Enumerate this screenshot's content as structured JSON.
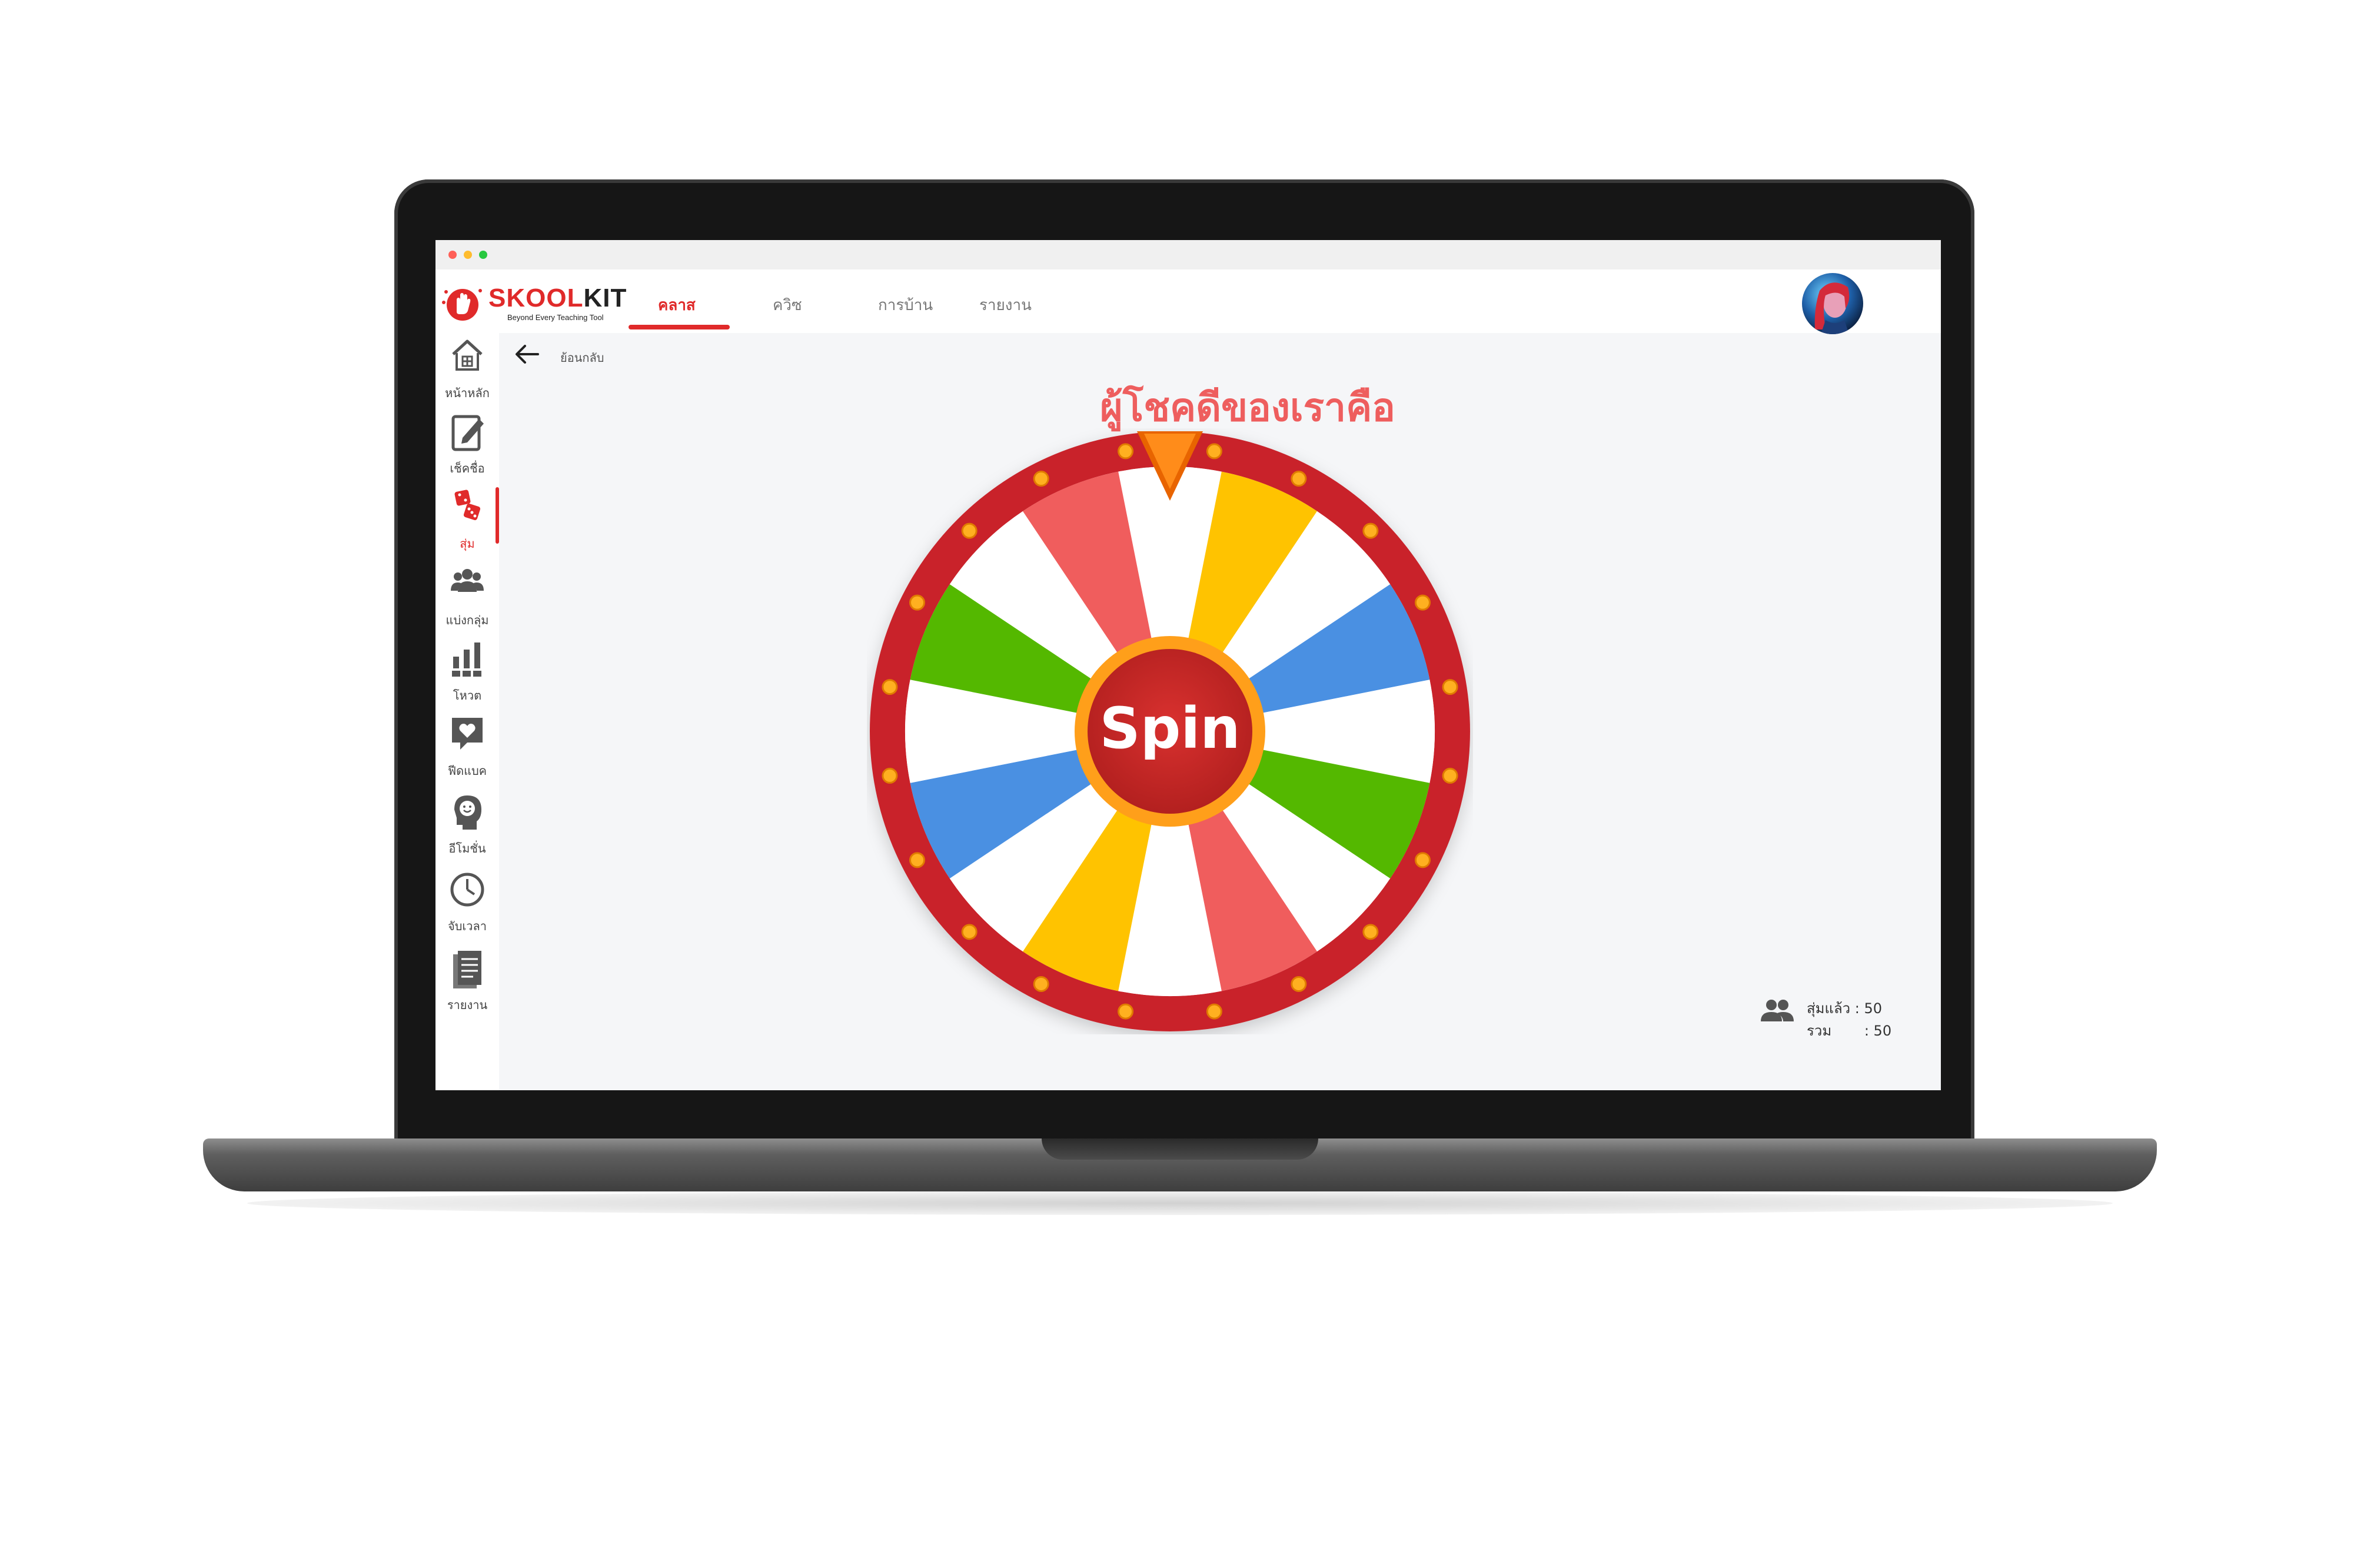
{
  "app": {
    "brand": {
      "name_red": "SKOOL",
      "name_dark": "KIT",
      "tagline": "Beyond Every Teaching Tool"
    },
    "window_dots": [
      "#ff5f57",
      "#febc2e",
      "#28c840"
    ]
  },
  "topnav": {
    "tabs": [
      {
        "label": "คลาส",
        "active": true
      },
      {
        "label": "ควิซ",
        "active": false
      },
      {
        "label": "การบ้าน",
        "active": false
      },
      {
        "label": "รายงาน",
        "active": false
      }
    ]
  },
  "sidebar": {
    "items": [
      {
        "label": "หน้าหลัก",
        "icon": "home-icon",
        "active": false
      },
      {
        "label": "เช็คชื่อ",
        "icon": "checklist-edit-icon",
        "active": false
      },
      {
        "label": "สุ่ม",
        "icon": "dice-icon",
        "active": true
      },
      {
        "label": "แบ่งกลุ่ม",
        "icon": "group-icon",
        "active": false
      },
      {
        "label": "โหวต",
        "icon": "vote-chart-icon",
        "active": false
      },
      {
        "label": "ฟีดแบค",
        "icon": "feedback-heart-icon",
        "active": false
      },
      {
        "label": "อีโมชั่น",
        "icon": "emotion-face-icon",
        "active": false
      },
      {
        "label": "จับเวลา",
        "icon": "clock-icon",
        "active": false
      },
      {
        "label": "รายงาน",
        "icon": "report-icon",
        "active": false
      }
    ]
  },
  "back": {
    "label": "ย้อนกลับ",
    "icon": "arrow-left-icon"
  },
  "main": {
    "title": "ผู้โชคดีของเราคือ",
    "spin_label": "Spin",
    "wheel_segment_colors": [
      "#ffffff",
      "#ffc300",
      "#ffffff",
      "#4a90e2",
      "#ffffff",
      "#54b800",
      "#ffffff",
      "#f05d5d",
      "#ffffff",
      "#ffc300",
      "#ffffff",
      "#4a90e2",
      "#ffffff",
      "#54b800",
      "#ffffff",
      "#f05d5d"
    ],
    "rim_color": "#c9242b",
    "pointer_color": "#ff7a00"
  },
  "stats": {
    "icon": "people-icon",
    "rows": [
      {
        "label": "สุ่มแล้ว",
        "value": ": 50"
      },
      {
        "label": "รวม",
        "value": ": 50"
      }
    ]
  },
  "colors": {
    "accent": "#e02a2a",
    "title": "#ee5e5e"
  }
}
